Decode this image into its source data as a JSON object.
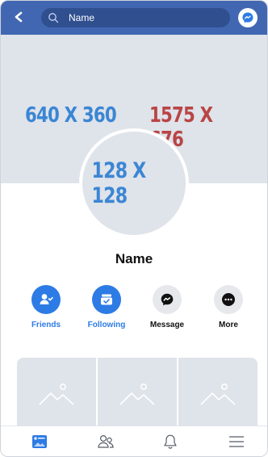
{
  "search": {
    "value": "Name",
    "placeholder": "Name"
  },
  "cover": {
    "left_label": "640 X 360",
    "right_label": "1575 X 676"
  },
  "profile": {
    "avatar_label": "128 X 128",
    "name": "Name"
  },
  "actions": [
    {
      "label": "Friends",
      "icon": "friends-icon"
    },
    {
      "label": "Following",
      "icon": "following-icon"
    },
    {
      "label": "Message",
      "icon": "messenger-icon"
    },
    {
      "label": "More",
      "icon": "more-icon"
    }
  ],
  "photos": {
    "count": 3,
    "icon": "image-placeholder-icon"
  },
  "bottom_nav": [
    {
      "icon": "feed-icon",
      "active": true
    },
    {
      "icon": "friends-outline-icon",
      "active": false
    },
    {
      "icon": "bell-icon",
      "active": false
    },
    {
      "icon": "menu-icon",
      "active": false
    }
  ],
  "colors": {
    "brand": "#4267b2",
    "accent": "#2d7be5",
    "placeholder_blue": "#3b86d4",
    "placeholder_red": "#b94545",
    "placeholder_bg": "#dfe3ea"
  }
}
